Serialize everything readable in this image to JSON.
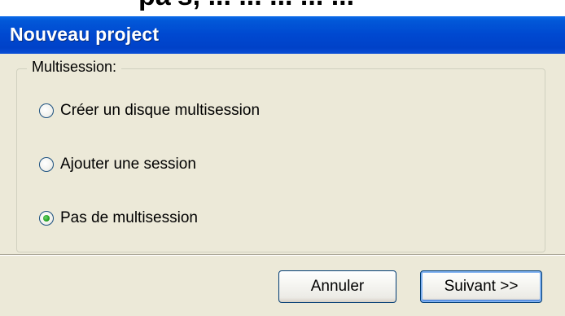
{
  "top_strip": {
    "partial_text": "pa's, ... ... ... ... ..."
  },
  "window": {
    "title": "Nouveau project"
  },
  "group": {
    "legend": "Multisession:",
    "options": [
      {
        "label": "Créer un disque multisession",
        "checked": false
      },
      {
        "label": "Ajouter une session",
        "checked": false
      },
      {
        "label": "Pas de multisession",
        "checked": true
      }
    ]
  },
  "buttons": {
    "cancel_label": "Annuler",
    "next_label": "Suivant >>"
  },
  "colors": {
    "titlebar": "#0048d0",
    "dialog_bg": "#ece9d8",
    "radio_checked": "#21a121",
    "button_border": "#003c74"
  }
}
